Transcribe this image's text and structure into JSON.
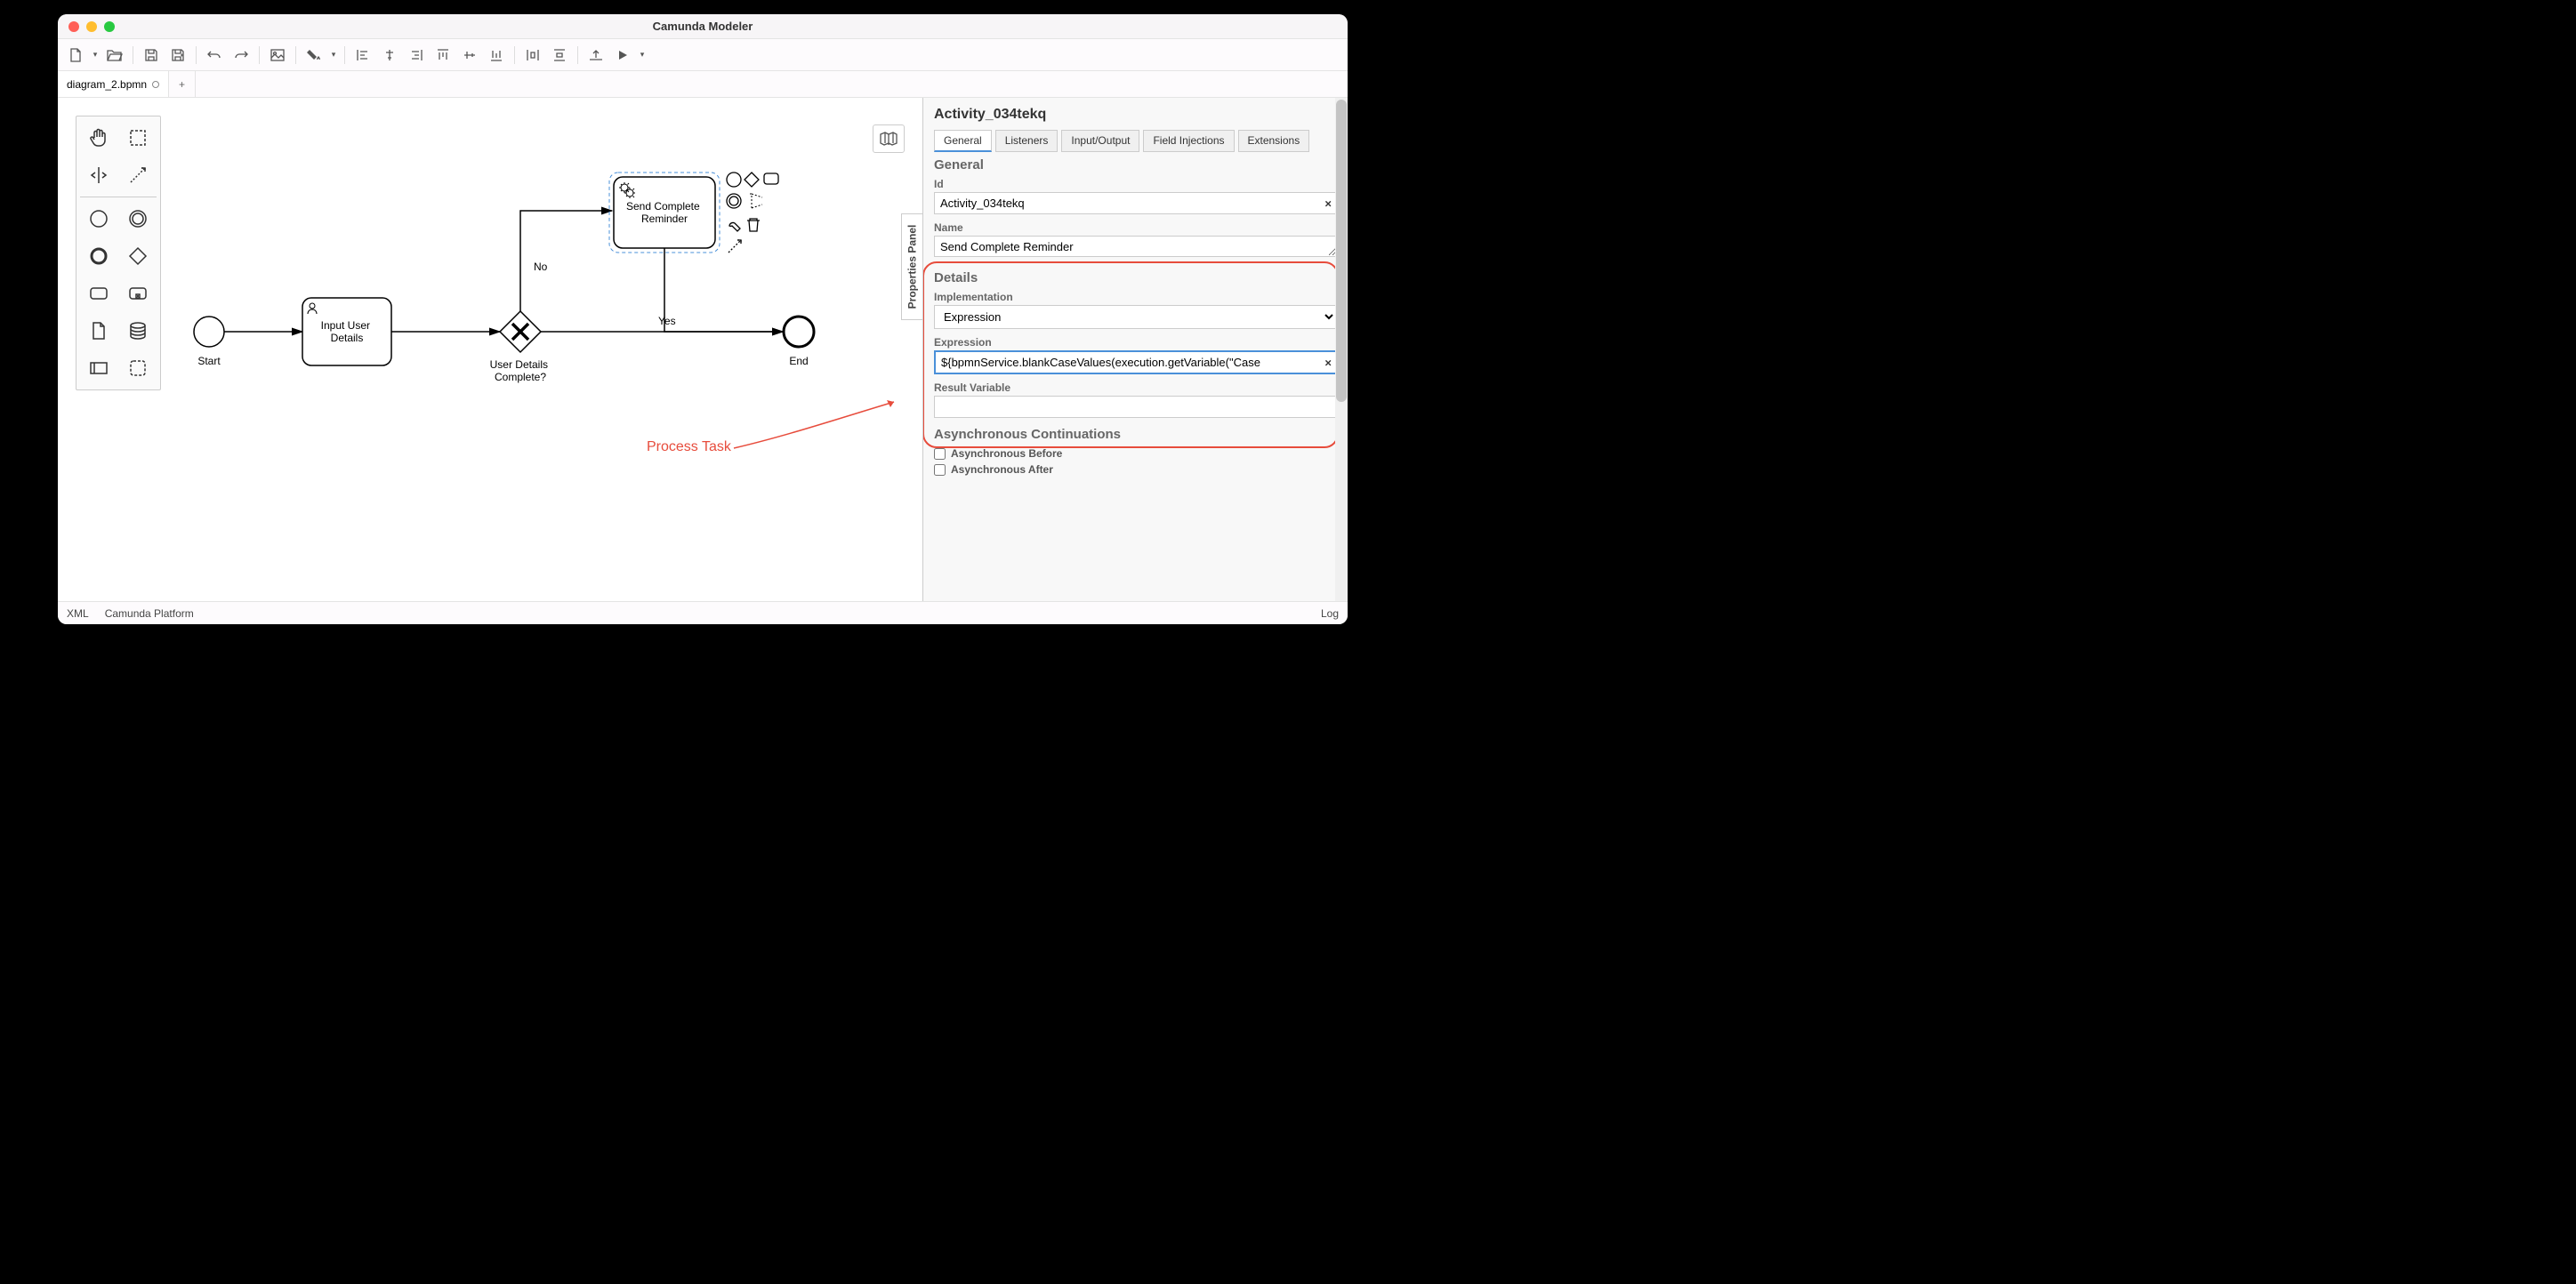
{
  "window": {
    "title": "Camunda Modeler"
  },
  "tab": {
    "name": "diagram_2.bpmn",
    "add": "+"
  },
  "canvas": {
    "start_label": "Start",
    "task1": "Input User Details",
    "gateway_label": "User Details Complete?",
    "no_label": "No",
    "yes_label": "Yes",
    "task2": "Send Complete Reminder",
    "end_label": "End"
  },
  "annotation": {
    "process_task": "Process Task"
  },
  "properties": {
    "handle": "Properties Panel",
    "title": "Activity_034tekq",
    "tabs": [
      "General",
      "Listeners",
      "Input/Output",
      "Field Injections",
      "Extensions"
    ],
    "section_general": "General",
    "id_label": "Id",
    "id_value": "Activity_034tekq",
    "name_label": "Name",
    "name_value": "Send Complete Reminder",
    "section_details": "Details",
    "impl_label": "Implementation",
    "impl_value": "Expression",
    "expr_label": "Expression",
    "expr_value": "${bpmnService.blankCaseValues(execution.getVariable(\"Case",
    "rv_label": "Result Variable",
    "rv_value": "",
    "section_async": "Asynchronous Continuations",
    "async_before": "Asynchronous Before",
    "async_after": "Asynchronous After"
  },
  "statusbar": {
    "xml": "XML",
    "platform": "Camunda Platform",
    "log": "Log"
  }
}
